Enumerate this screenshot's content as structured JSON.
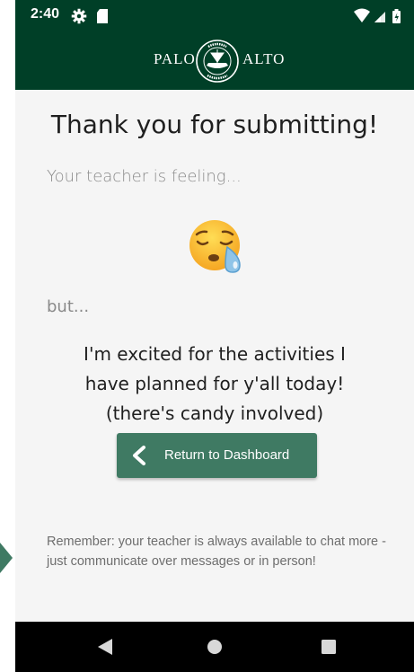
{
  "status_bar": {
    "time": "2:40",
    "icons": [
      "gear-icon",
      "sd-card-icon",
      "wifi-icon",
      "signal-icon",
      "battery-charging-icon"
    ]
  },
  "header": {
    "brand_left": "PALO",
    "brand_right": "ALTO",
    "seal_text_top": "PALO ALTO",
    "seal_text_bottom": "SENIOR HIGH SCHOOL",
    "seal_text_middle": "LIBRARY",
    "background_color": "#003f27"
  },
  "main": {
    "title": "Thank you for submitting!",
    "feeling_label": "Your teacher is feeling...",
    "mood_emoji": "sleepy-face",
    "but_label": "but...",
    "message_lines": [
      "I'm excited for the activities I",
      "have planned for y'all today!",
      "(there's candy involved)"
    ],
    "return_button": {
      "label": "Return to Dashboard",
      "icon": "chevron-left-icon",
      "color": "#3f7a63"
    },
    "reminder": "Remember: your teacher is always available to chat more - just communicate over messages or in person!"
  },
  "nav_bar": {
    "icons": [
      "back-triangle-icon",
      "home-circle-icon",
      "recents-square-icon"
    ]
  }
}
